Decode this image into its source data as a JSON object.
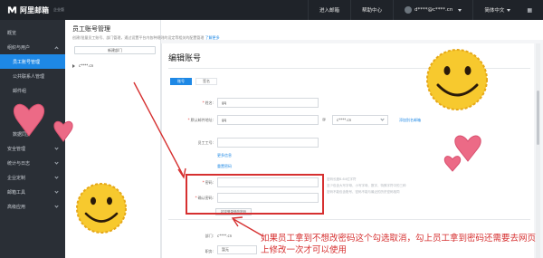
{
  "app": {
    "logo_text": "阿里邮箱",
    "logo_sub": "企业版"
  },
  "topbar": {
    "links": [
      "进入邮箱",
      "帮助中心"
    ],
    "user": "d****@c****.cn",
    "language": "简体中文"
  },
  "sidebar": {
    "items": [
      {
        "label": "概览"
      },
      {
        "label": "组织与用户",
        "expanded": true
      },
      {
        "label": "员工账号管理",
        "active": true,
        "sub": true
      },
      {
        "label": "公共联系人管理",
        "sub": true
      },
      {
        "label": "邮件组",
        "sub": true
      },
      {
        "label": "",
        "sub": true
      },
      {
        "label": "",
        "sub": true
      },
      {
        "label": "数据同步",
        "sub": true
      },
      {
        "label": "安全管理"
      },
      {
        "label": "统计与日志"
      },
      {
        "label": "企业定制"
      },
      {
        "label": "邮箱工具"
      },
      {
        "label": "高级应用"
      }
    ]
  },
  "tree": {
    "title": "员工账号管理",
    "description": "创建/批量员工账号、部门管理，通过设置平台内各种规则的设定等相关的配置管理",
    "description_link": "了解更多",
    "new_dept_button": "新建部门",
    "root_node": "c****.cn"
  },
  "form": {
    "title": "编辑账号",
    "tabs": [
      "账号",
      "签名"
    ],
    "name_label": "姓名",
    "name_value": "gq",
    "email_label": "默认邮件地址",
    "email_local": "gq",
    "at": "@",
    "email_domain": "c****.cn",
    "add_email_link": "添加别名邮箱",
    "employee_no_label": "员工工号",
    "more_link": "更多信息",
    "reset_password_link": "重置密码",
    "password_label": "密码",
    "confirm_password_label": "确认密码",
    "password_hint_1": "密码长度8-64位字符",
    "password_hint_2": "至少包含大写字母、小写字母、数字、特殊字符中的三种",
    "password_hint_3": "密码不能包含账号、密码不能与最近的历史密码相同",
    "force_change_label": "初次登录修改密码",
    "dept_label": "部门",
    "dept_value": "c****.cn",
    "bottom_field_label": "职务",
    "bottom_field_value": "暂无"
  },
  "annotation": {
    "text": "如果员工拿到不想改密码这个勾选取消，勾上员工拿到密码还需要去网页上修改一次才可以使用"
  },
  "colors": {
    "accent": "#1e88e5",
    "annotation_red": "#d63030",
    "sidebar_bg": "#2a2f36",
    "topbar_bg": "#1f2329"
  }
}
